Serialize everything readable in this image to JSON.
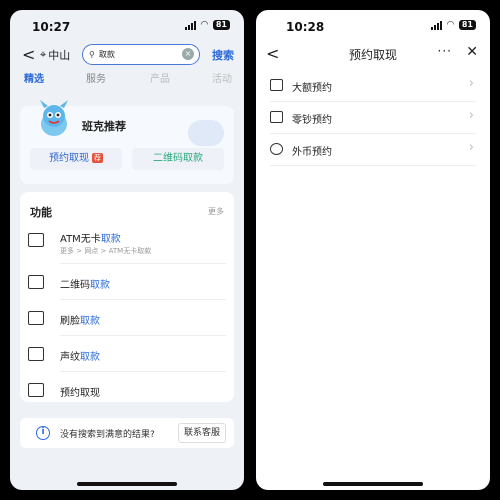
{
  "left": {
    "status": {
      "time": "10:27",
      "battery": "81"
    },
    "header": {
      "location": "中山",
      "search_value": "取款",
      "search_button": "搜索"
    },
    "tabs": [
      {
        "label": "精选"
      },
      {
        "label": "服务"
      },
      {
        "label": "产品"
      },
      {
        "label": "活动"
      }
    ],
    "recommend": {
      "title": "班克推荐",
      "btn_yuyue": "预约取现",
      "tag": "荐",
      "btn_qr": "二维码取款"
    },
    "functions": {
      "title": "功能",
      "more": "更多",
      "items": [
        {
          "prefix": "ATM无卡",
          "highlight": "取款",
          "sub": "更多 > 网点 > ATM无卡取款"
        },
        {
          "prefix": "二维码",
          "highlight": "取款"
        },
        {
          "prefix": "刷脸",
          "highlight": "取款"
        },
        {
          "prefix": "声纹",
          "highlight": "取款"
        },
        {
          "prefix": "预约取现",
          "highlight": ""
        }
      ]
    },
    "bottom": {
      "text": "没有搜索到满意的结果?",
      "service": "联系客服"
    }
  },
  "right": {
    "status": {
      "time": "10:28",
      "battery": "81"
    },
    "header": {
      "title": "预约取现",
      "dots": "···",
      "close": "✕"
    },
    "items": [
      {
        "label": "大额预约",
        "icon": "large-amount-icon"
      },
      {
        "label": "零钞预约",
        "icon": "small-change-icon"
      },
      {
        "label": "外币预约",
        "icon": "foreign-currency-icon"
      }
    ]
  }
}
